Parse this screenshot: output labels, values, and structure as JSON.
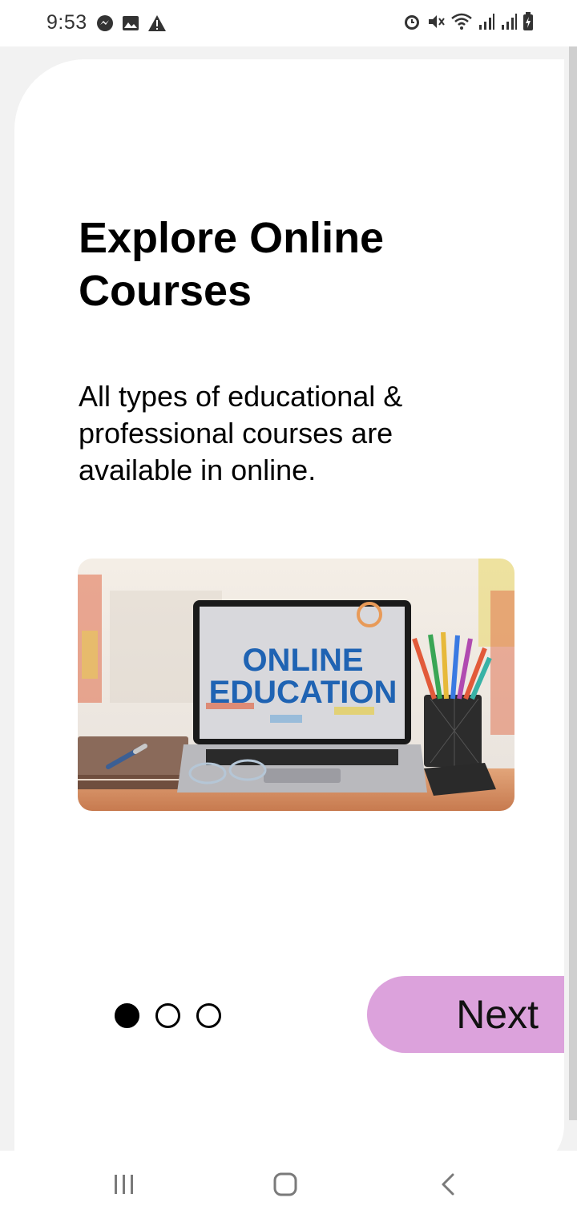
{
  "status_bar": {
    "time": "9:53",
    "left_icons": [
      "messenger-icon",
      "image-icon",
      "warning-icon"
    ],
    "right_icons": [
      "alarm-icon",
      "mute-icon",
      "wifi-icon",
      "signal-icon",
      "signal-icon",
      "battery-charging-icon"
    ]
  },
  "onboarding": {
    "title": "Explore Online Courses",
    "subtitle": "All types of educational & professional courses are available in online.",
    "illustration": {
      "screen_text_line1": "ONLINE",
      "screen_text_line2": "EDUCATION"
    },
    "page_indicator": {
      "total": 3,
      "current": 1
    },
    "next_label": "Next",
    "colors": {
      "next_button": "#dca2dc",
      "background": "#f2f2f2"
    }
  },
  "nav_bar": {
    "buttons": [
      "recent-apps-icon",
      "home-icon",
      "back-icon"
    ]
  }
}
